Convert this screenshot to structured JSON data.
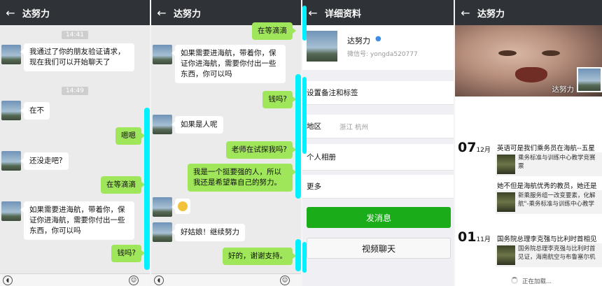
{
  "contact_name": "达努力",
  "back_glyph": "←",
  "panel1": {
    "timestamps": [
      "14:41",
      "14:49"
    ],
    "messages": [
      {
        "side": "recv",
        "text": "我通过了你的朋友验证请求，现在我们可以开始聊天了"
      },
      {
        "side": "recv",
        "text": "在不"
      },
      {
        "side": "sent",
        "text": "嗯嗯"
      },
      {
        "side": "recv",
        "text": "还没走吧?"
      },
      {
        "side": "sent",
        "text": "在等滴滴"
      },
      {
        "side": "recv",
        "text": "如果需要进海航，带着你，保证你进海航，需要你付出一些东西，你可以吗"
      },
      {
        "side": "sent",
        "text": "钱吗?"
      }
    ]
  },
  "panel2": {
    "messages": [
      {
        "side": "sent",
        "text": "在等滴滴"
      },
      {
        "side": "recv",
        "text": "如果需要进海航，带着你，保证你进海航，需要你付出一些东西，你可以吗"
      },
      {
        "side": "sent",
        "text": "钱吗?"
      },
      {
        "side": "recv",
        "text": "如果是人呢"
      },
      {
        "side": "sent",
        "text": "老师在试探我吗?"
      },
      {
        "side": "sent",
        "text": "我是一个挺要强的人，所以我还是希望靠自己的努力。"
      },
      {
        "side": "recv",
        "text": "好姑娘！继续努力"
      },
      {
        "side": "sent",
        "text": "好的，谢谢支持。"
      }
    ]
  },
  "panel3": {
    "title": "详细资料",
    "wechat_id": "微信号: yongda520777",
    "rows": {
      "remark": "设置备注和标签",
      "region_label": "地区",
      "region_value": "浙江  杭州",
      "album": "个人相册",
      "more": "更多"
    },
    "send_button": "发消息",
    "video_button": "视频聊天"
  },
  "panel4": {
    "posts": [
      {
        "day": "07",
        "month": "12月",
        "title": "英语可是我们乘务员在海航--五星",
        "snippet": "乘务标准与训练中心教学竞赛\n票"
      },
      {
        "day": "",
        "month": "",
        "title": "她不但是海航优秀的教员，她还是",
        "snippet": "新乘服务组一改变要素，化解\n航\"-乘务标准与训练中心教学"
      },
      {
        "day": "01",
        "month": "11月",
        "title": "国务院总理李克强与比利时首相见",
        "snippet": "国务院总理李克强与比利时首\n见证，海南航空与布鲁塞尔机"
      }
    ],
    "loading": "正在加载..."
  }
}
